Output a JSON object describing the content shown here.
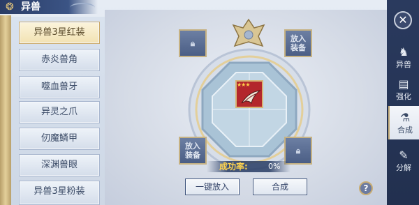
{
  "window": {
    "title": "异兽"
  },
  "list": {
    "items": [
      {
        "label": "异兽3星红装",
        "selected": true
      },
      {
        "label": "赤炎兽角",
        "selected": false
      },
      {
        "label": "噬血兽牙",
        "selected": false
      },
      {
        "label": "异灵之爪",
        "selected": false
      },
      {
        "label": "仞魔鳞甲",
        "selected": false
      },
      {
        "label": "深渊兽眼",
        "selected": false
      },
      {
        "label": "异兽3星粉装",
        "selected": false
      }
    ]
  },
  "slots": {
    "top_right": {
      "line1": "放入",
      "line2": "装备"
    },
    "bottom_left": {
      "line1": "放入",
      "line2": "装备"
    }
  },
  "center_item": {
    "stars": "★★★"
  },
  "success": {
    "label": "成功率:",
    "value": "0%"
  },
  "buttons": {
    "auto_fill": "一键放入",
    "synthesize": "合成",
    "help": "?"
  },
  "tabs": [
    {
      "label": "异兽",
      "icon": "beast-icon",
      "active": false
    },
    {
      "label": "强化",
      "icon": "enhance-icon",
      "active": false
    },
    {
      "label": "合成",
      "icon": "synthesize-icon",
      "active": true
    },
    {
      "label": "分解",
      "icon": "decompose-icon",
      "active": false
    }
  ],
  "colors": {
    "accent_gold": "#c6b283",
    "success_label": "#ffd34d",
    "item_bg": "#b3272c",
    "panel_dark": "#2a3a5e"
  }
}
